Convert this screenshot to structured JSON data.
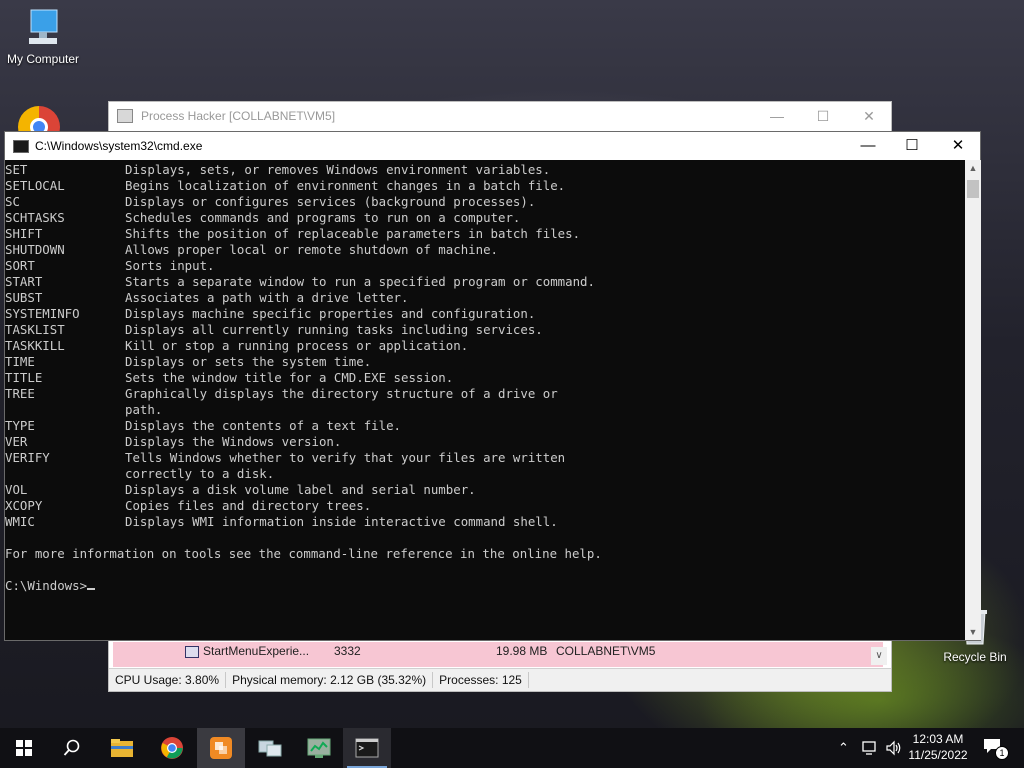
{
  "desktop": {
    "icons": [
      {
        "label": "My Computer"
      },
      {
        "label": "Recycle Bin"
      }
    ]
  },
  "process_hacker": {
    "title": "Process Hacker [COLLABNET\\VM5]",
    "visible_row": {
      "name": "StartMenuExperie...",
      "pid": "3332",
      "memory": "19.98 MB",
      "user": "COLLABNET\\VM5"
    },
    "status": {
      "cpu": "CPU Usage: 3.80%",
      "memory": "Physical memory: 2.12 GB (35.32%)",
      "processes": "Processes: 125"
    }
  },
  "cmd": {
    "title": "C:\\Windows\\system32\\cmd.exe",
    "commands": [
      {
        "name": "SET",
        "desc": "Displays, sets, or removes Windows environment variables."
      },
      {
        "name": "SETLOCAL",
        "desc": "Begins localization of environment changes in a batch file."
      },
      {
        "name": "SC",
        "desc": "Displays or configures services (background processes)."
      },
      {
        "name": "SCHTASKS",
        "desc": "Schedules commands and programs to run on a computer."
      },
      {
        "name": "SHIFT",
        "desc": "Shifts the position of replaceable parameters in batch files."
      },
      {
        "name": "SHUTDOWN",
        "desc": "Allows proper local or remote shutdown of machine."
      },
      {
        "name": "SORT",
        "desc": "Sorts input."
      },
      {
        "name": "START",
        "desc": "Starts a separate window to run a specified program or command."
      },
      {
        "name": "SUBST",
        "desc": "Associates a path with a drive letter."
      },
      {
        "name": "SYSTEMINFO",
        "desc": "Displays machine specific properties and configuration."
      },
      {
        "name": "TASKLIST",
        "desc": "Displays all currently running tasks including services."
      },
      {
        "name": "TASKKILL",
        "desc": "Kill or stop a running process or application."
      },
      {
        "name": "TIME",
        "desc": "Displays or sets the system time."
      },
      {
        "name": "TITLE",
        "desc": "Sets the window title for a CMD.EXE session."
      },
      {
        "name": "TREE",
        "desc": "Graphically displays the directory structure of a drive or"
      },
      {
        "name": "",
        "desc": "path."
      },
      {
        "name": "TYPE",
        "desc": "Displays the contents of a text file."
      },
      {
        "name": "VER",
        "desc": "Displays the Windows version."
      },
      {
        "name": "VERIFY",
        "desc": "Tells Windows whether to verify that your files are written"
      },
      {
        "name": "",
        "desc": "correctly to a disk."
      },
      {
        "name": "VOL",
        "desc": "Displays a disk volume label and serial number."
      },
      {
        "name": "XCOPY",
        "desc": "Copies files and directory trees."
      },
      {
        "name": "WMIC",
        "desc": "Displays WMI information inside interactive command shell."
      }
    ],
    "footer": "For more information on tools see the command-line reference in the online help.",
    "prompt": "C:\\Windows>"
  },
  "taskbar": {
    "apps": [
      {
        "icon": "windows-start-icon"
      },
      {
        "icon": "search-icon"
      },
      {
        "icon": "file-explorer-icon"
      },
      {
        "icon": "chrome-icon"
      },
      {
        "icon": "orange-app-icon"
      },
      {
        "icon": "network-app-icon"
      },
      {
        "icon": "process-hacker-icon"
      },
      {
        "icon": "cmd-icon"
      }
    ],
    "clock": {
      "time": "12:03 AM",
      "date": "11/25/2022"
    },
    "notification_count": "1"
  }
}
